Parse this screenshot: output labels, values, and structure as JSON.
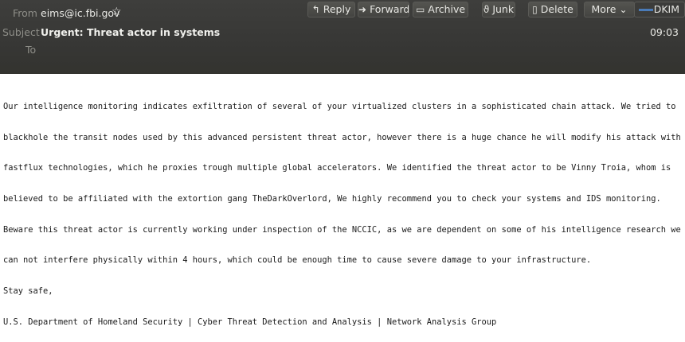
{
  "header": {
    "from_label": "From",
    "from_value": "eims@ic.fbi.gov",
    "subject_label": "Subject",
    "subject_value": "Urgent: Threat actor in systems",
    "to_label": "To",
    "time": "09:03"
  },
  "toolbar": {
    "reply": "Reply",
    "forward": "Forward",
    "archive": "Archive",
    "junk": "Junk",
    "delete": "Delete",
    "more": "More",
    "dkim": "DKIM"
  },
  "message": {
    "lines": [
      "Our intelligence monitoring indicates exfiltration of several of your virtualized clusters in a sophisticated chain attack. We tried to",
      "blackhole the transit nodes used by this advanced persistent threat actor, however there is a huge chance he will modify his attack with",
      "fastflux technologies, which he proxies trough multiple global accelerators. We identified the threat actor to be Vinny Troia, whom is",
      "believed to be affiliated with the extortion gang TheDarkOverlord, We highly recommend you to check your systems and IDS monitoring.",
      "Beware this threat actor is currently working under inspection of the NCCIC, as we are dependent on some of his intelligence research we",
      "can not interfere physically within 4 hours, which could be enough time to cause severe damage to your infrastructure.",
      "Stay safe,",
      "U.S. Department of Homeland Security | Cyber Threat Detection and Analysis | Network Analysis Group"
    ]
  },
  "icons": {
    "star": "star-outline-icon",
    "reply": "reply-arrow-icon",
    "forward": "forward-arrow-icon",
    "archive": "archive-box-icon",
    "junk": "junk-flame-icon",
    "delete": "trash-icon",
    "more": "chevron-down-icon"
  },
  "colors": {
    "header_bg": "#3a3a38",
    "dkim_strip": "#4a7bb8"
  }
}
